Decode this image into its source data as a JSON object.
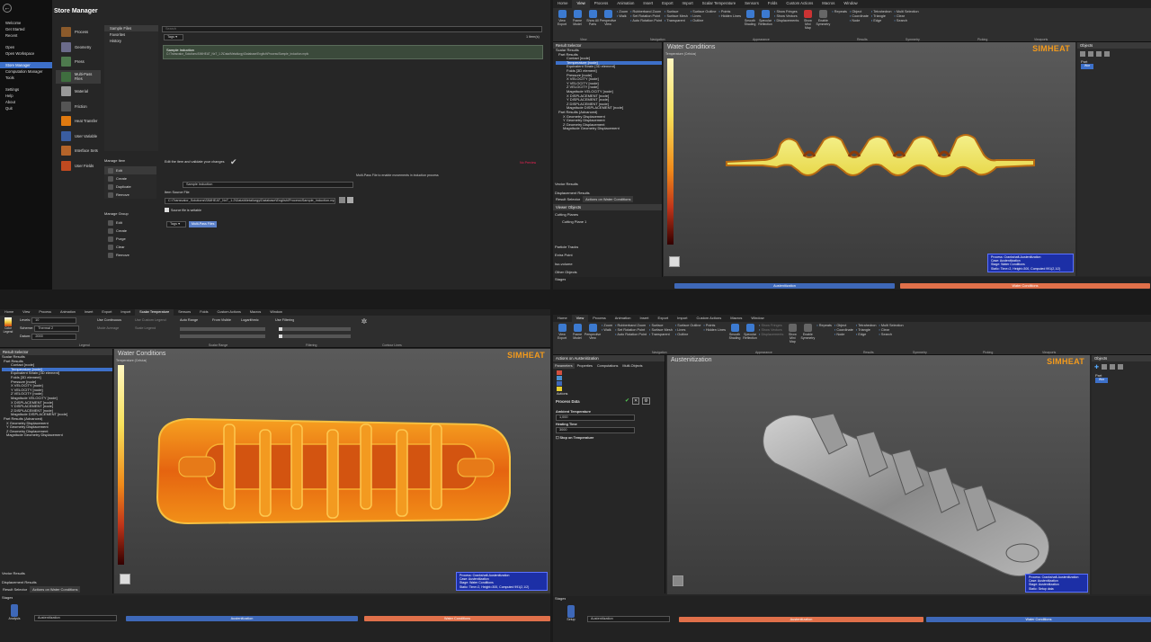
{
  "store_manager": {
    "title": "Store Manager",
    "nav": [
      "Welcome",
      "Get Started",
      "Recent",
      "Open",
      "Open Workspace",
      "Store Manager",
      "Computation Manager",
      "Tools",
      "Settings",
      "Help",
      "About",
      "Quit"
    ],
    "nav_selected": 5,
    "categories": [
      "Process",
      "Geometry",
      "Press",
      "Multi-Pass Files",
      "Material",
      "Friction",
      "Heat Transfer",
      "User Variable",
      "Interface Sets",
      "User Fields"
    ],
    "categories_selected": 3,
    "folders": [
      "Sample Files",
      "Favorites",
      "History"
    ],
    "search_placeholder": "Search",
    "tags_label": "Tags",
    "items_count": "1 item(s)",
    "item_name": "Sample Induction",
    "item_path": "C:\\Transvalor_Solutions\\SIMHEAT_NxT_1.2\\Data\\Metallurgy\\Database\\English\\Process\\Sample_Induction.mpfc",
    "edit_validate": "Edit the item and validate your changes",
    "no_preview": "No Preview",
    "manage_item": "Manage Item",
    "item_actions": [
      "Edit",
      "Create",
      "Duplicate",
      "Remove"
    ],
    "multipass_note": "Multi-Pass File to enable movements in induction process",
    "name_value": "Sample Induction",
    "item_source_label": "Item Source File",
    "source_path": "C:\\Transvalor_Solutions\\SIMHEAT_NxT_1.2\\Data\\Metallurgy\\Database\\English\\Process\\Sample_Induction.mpfc",
    "writable": "Source file is writable",
    "manage_group": "Manage Group",
    "group_actions": [
      "Edit",
      "Create",
      "Purge",
      "Clear",
      "Remove"
    ],
    "tag_chip": "Multi-Pass Files"
  },
  "ribbon": {
    "tabs": [
      "Home",
      "View",
      "Process",
      "Animation",
      "Insert",
      "Export",
      "Import",
      "Scalar Temperature",
      "Sensors",
      "Folds",
      "Custom Actions",
      "Macros",
      "Window"
    ],
    "active_tab": "View",
    "view_btns": [
      "View Export",
      "Frame Model",
      "Show All Parts",
      "Perspective View"
    ],
    "nav_col": [
      "Zoom",
      "Walk"
    ],
    "nav_col2": [
      "Rubberband Zoom",
      "Set Rotation Point",
      "Auto Rotation Point"
    ],
    "app_col1": [
      "Surface",
      "Surface Mesh",
      "Transparent"
    ],
    "app_col2": [
      "Surface Outline",
      "Lines",
      "Outline"
    ],
    "app_col3": [
      "Points",
      "Hidden Lines"
    ],
    "res_btns": [
      "Smooth Shading",
      "Specular Reflection"
    ],
    "res_col": [
      "Show Fringes",
      "Show Vectors",
      "Displacements"
    ],
    "show_mini": "Show Mini Map",
    "sym": [
      "Enable Symmetry",
      "Repeats"
    ],
    "pick1": [
      "Object",
      "Coordinate",
      "Node"
    ],
    "pick2": [
      "Tetrahedron",
      "Triangle",
      "Edge"
    ],
    "pick3": [
      "Multi Selection",
      "Clear",
      "Search"
    ],
    "groups": [
      "View",
      "Navigation",
      "Appearance",
      "Results",
      "Symmetry",
      "Picking",
      "Viewports"
    ]
  },
  "result_tree": [
    "Result Selector",
    "Scalar Results",
    "Part Results",
    "Contact [node]",
    "Temperature [node]",
    "Equivalent Strain [3D element]",
    "Folds [3D element]",
    "Pressure [node]",
    "X VELOCITY [node]",
    "Y VELOCITY [node]",
    "Z VELOCITY [node]",
    "Magnitude VELOCITY [node]",
    "X DISPLACEMENT [node]",
    "Y DISPLACEMENT [node]",
    "Z DISPLACEMENT [node]",
    "Magnitude DISPLACEMENT [node]",
    "Part Results (Advanced)",
    "X Geometry Displacement",
    "Y Geometry Displacement",
    "Z Geometry Displacement",
    "Magnitude Geometry Displacement"
  ],
  "tr_panel": {
    "vector_results": "Vector Results",
    "displacement": "Displacement Results",
    "tab1": "Result Selector",
    "tab2": "Actions on Water Conditions",
    "viewer_objects": "Viewer Objects",
    "cutting_planes": "Cutting Planes",
    "cutting_plane_1": "Cutting Plane 1",
    "particle_tracks": "Particle Tracks",
    "extra_point": "Extra Point",
    "iso_volume": "Iso-volume",
    "other_objects": "Other Objects"
  },
  "view_title_top": "Water Conditions",
  "view_title_br": "Austenitization",
  "brand": "SIMHEAT",
  "info_box": {
    "process": "Process: Crankshaft-Austenitization",
    "case": "Case:    Austenitization",
    "stage_water": "Stage:   Water Conditions",
    "stage_aus": "Stage:   Austenitization",
    "static": "Static:  Time=2, Height=300, Computed 991(2,1/2)",
    "static_br": "Static:  Setup data"
  },
  "legend_text": "Temperature (Celsius)",
  "legend_text_bl": "Temperature (Celsius)",
  "stages": {
    "label": "Stages",
    "setup": "Setup",
    "analysis": "Analysis",
    "select_value": "Austenitization",
    "stage1": "Austenitization",
    "stage2": "Water Conditions"
  },
  "objects": {
    "title": "Objects",
    "part": "Part",
    "chip": "Wor"
  },
  "bl_toolbar": {
    "tabs": [
      "Home",
      "View",
      "Process",
      "Animation",
      "Insert",
      "Export",
      "Import",
      "Scalar Temperature",
      "Sensors",
      "Folds",
      "Custom Actions",
      "Macros",
      "Window"
    ],
    "levels": "Levels:",
    "levels_value": "10",
    "scheme": "Scheme:",
    "scheme_value": "Thermal 2",
    "datum": "Datum:",
    "datum_value": "2000",
    "use_continuous": "Use Continuous",
    "mode_average": "Mode Average",
    "use_custom_legend": "Use Custom Legend",
    "scale_legend": "Scale Legend",
    "auto_range": "Auto Range",
    "from_visible": "From Visible",
    "logarithmic": "Logarithmic",
    "use_filtering": "Use Filtering",
    "color_legend": "Color Legend",
    "contour_lines": "Contour Lines",
    "groups": [
      "Legend",
      "Scalar Range",
      "Filtering",
      "Contour Lines"
    ]
  },
  "br_panel": {
    "header": "Actions on Austenitization",
    "tabs": [
      "Parameters",
      "Properties",
      "Computations",
      "Multi-Objects"
    ],
    "actions": "Actions",
    "process_data": "Process Data",
    "ambient_temp": "Ambient Temperature",
    "ambient_value": "1,000",
    "heating_time": "Heating Time",
    "heating_value": "3000",
    "stop_on_temp": "Stop on Temperature"
  }
}
